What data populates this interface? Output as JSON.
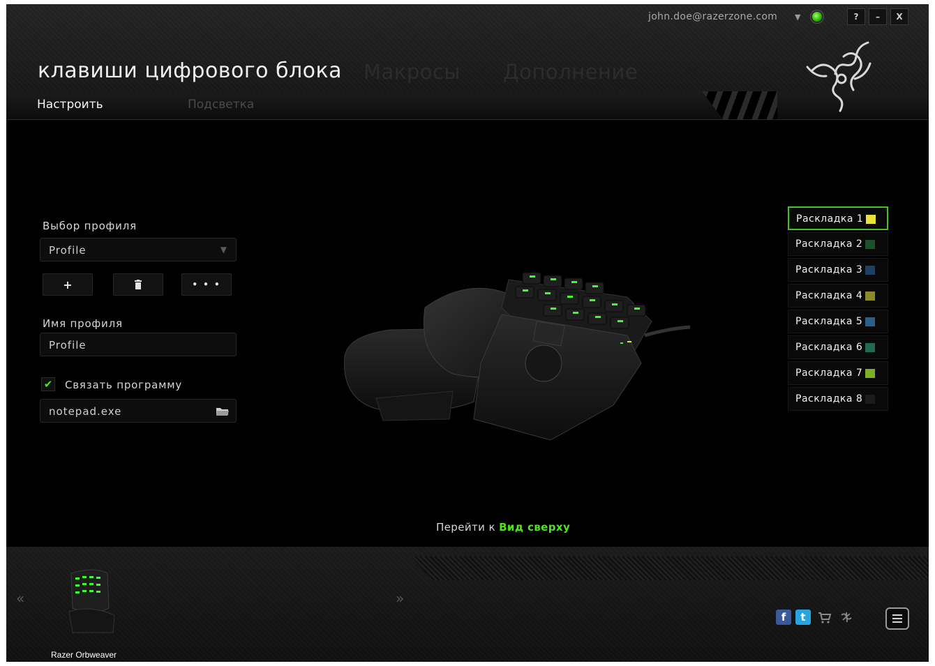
{
  "header": {
    "account_email": "john.doe@razerzone.com",
    "window_buttons": [
      "?",
      "–",
      "X"
    ],
    "page_title": "клавиши цифрового блока",
    "main_tabs": [
      "Макросы",
      "Дополнение"
    ],
    "sub_tabs": [
      {
        "label": "Настроить",
        "active": true
      },
      {
        "label": "Подсветка",
        "active": false
      }
    ]
  },
  "profile_panel": {
    "select_label": "Выбор профиля",
    "selected_profile": "Profile",
    "buttons": [
      "+",
      "🗑",
      "• • •"
    ],
    "name_label": "Имя профиля",
    "name_value": "Profile",
    "link_program_label": "Связать программу",
    "link_program_checked": true,
    "program_value": "notepad.exe"
  },
  "keymaps": [
    {
      "label": "Раскладка 1",
      "color": "#e8e23a",
      "active": true
    },
    {
      "label": "Раскладка 2",
      "color": "#1f4f2a",
      "active": false
    },
    {
      "label": "Раскладка 3",
      "color": "#1e3e66",
      "active": false
    },
    {
      "label": "Раскладка 4",
      "color": "#8a8a2a",
      "active": false
    },
    {
      "label": "Раскладка 5",
      "color": "#2a5f8a",
      "active": false
    },
    {
      "label": "Раскладка 6",
      "color": "#1e6a55",
      "active": false
    },
    {
      "label": "Раскладка 7",
      "color": "#7cae25",
      "active": false
    },
    {
      "label": "Раскладка 8",
      "color": "#1c1c1c",
      "active": false
    }
  ],
  "view_switch": {
    "prefix": "Перейти к",
    "link": "Вид сверху"
  },
  "footer": {
    "device_name": "Razer Orbweaver",
    "prev_arrow": "«",
    "next_arrow": "»",
    "social": [
      "f",
      "t",
      "cart",
      "razer"
    ],
    "colors": {
      "facebook": "#3b5998",
      "twitter": "#2aa3df",
      "accent": "#4ce61b"
    }
  }
}
